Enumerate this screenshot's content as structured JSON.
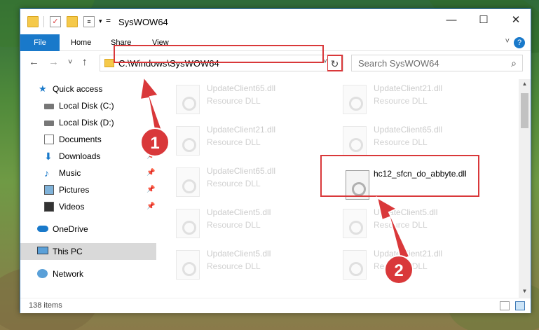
{
  "window": {
    "title": "SysWOW64"
  },
  "title_controls": {
    "minimize": "—",
    "maximize": "☐",
    "close": "✕"
  },
  "tabs": [
    {
      "label": "File"
    },
    {
      "label": "Home"
    },
    {
      "label": "Share"
    },
    {
      "label": "View"
    }
  ],
  "nav": {
    "back": "←",
    "forward": "→",
    "recent": "˅",
    "up": "↑",
    "address": "C:\\Windows\\SysWOW64",
    "refresh": "↻",
    "search_placeholder": "Search SysWOW64"
  },
  "sidebar": {
    "items": [
      {
        "label": "Quick access",
        "icon": "star-icon",
        "pinned": false
      },
      {
        "label": "Local Disk (C:)",
        "icon": "drive-icon",
        "pinned": false
      },
      {
        "label": "Local Disk (D:)",
        "icon": "drive-icon",
        "pinned": false
      },
      {
        "label": "Documents",
        "icon": "documents-icon",
        "pinned": false
      },
      {
        "label": "Downloads",
        "icon": "download-icon",
        "pinned": true
      },
      {
        "label": "Music",
        "icon": "music-icon",
        "pinned": true
      },
      {
        "label": "Pictures",
        "icon": "pictures-icon",
        "pinned": true
      },
      {
        "label": "Videos",
        "icon": "videos-icon",
        "pinned": true
      },
      {
        "label": "OneDrive",
        "icon": "onedrive-icon",
        "pinned": false
      },
      {
        "label": "This PC",
        "icon": "pc-icon",
        "pinned": false,
        "selected": true
      },
      {
        "label": "Network",
        "icon": "network-icon",
        "pinned": false
      }
    ]
  },
  "files": [
    {
      "name": "UpdateClient65.dll",
      "type": "Resource DLL",
      "faded": true
    },
    {
      "name": "UpdateClient21.dll",
      "type": "Resource DLL",
      "faded": true
    },
    {
      "name": "UpdateClient21.dll",
      "type": "Resource DLL",
      "faded": true
    },
    {
      "name": "UpdateClient65.dll",
      "type": "Resource DLL",
      "faded": true
    },
    {
      "name": "UpdateClient65.dll",
      "type": "Resource DLL",
      "faded": true
    },
    {
      "name": "hc12_sfcn_do_abbyte.dll",
      "type": "",
      "faded": false,
      "highlighted": true
    },
    {
      "name": "UpdateClient5.dll",
      "type": "Resource DLL",
      "faded": true
    },
    {
      "name": "UpdateClient5.dll",
      "type": "Resource DLL",
      "faded": true
    },
    {
      "name": "UpdateClient5.dll",
      "type": "Resource DLL",
      "faded": true
    },
    {
      "name": "UpdateClient21.dll",
      "type": "Resource DLL",
      "faded": true
    }
  ],
  "status": {
    "item_count": "138 items"
  },
  "callouts": [
    {
      "label": "1"
    },
    {
      "label": "2"
    }
  ],
  "colors": {
    "accent": "#1979ca",
    "highlight": "#d9383a",
    "selected_bg": "#d9d9d9"
  }
}
